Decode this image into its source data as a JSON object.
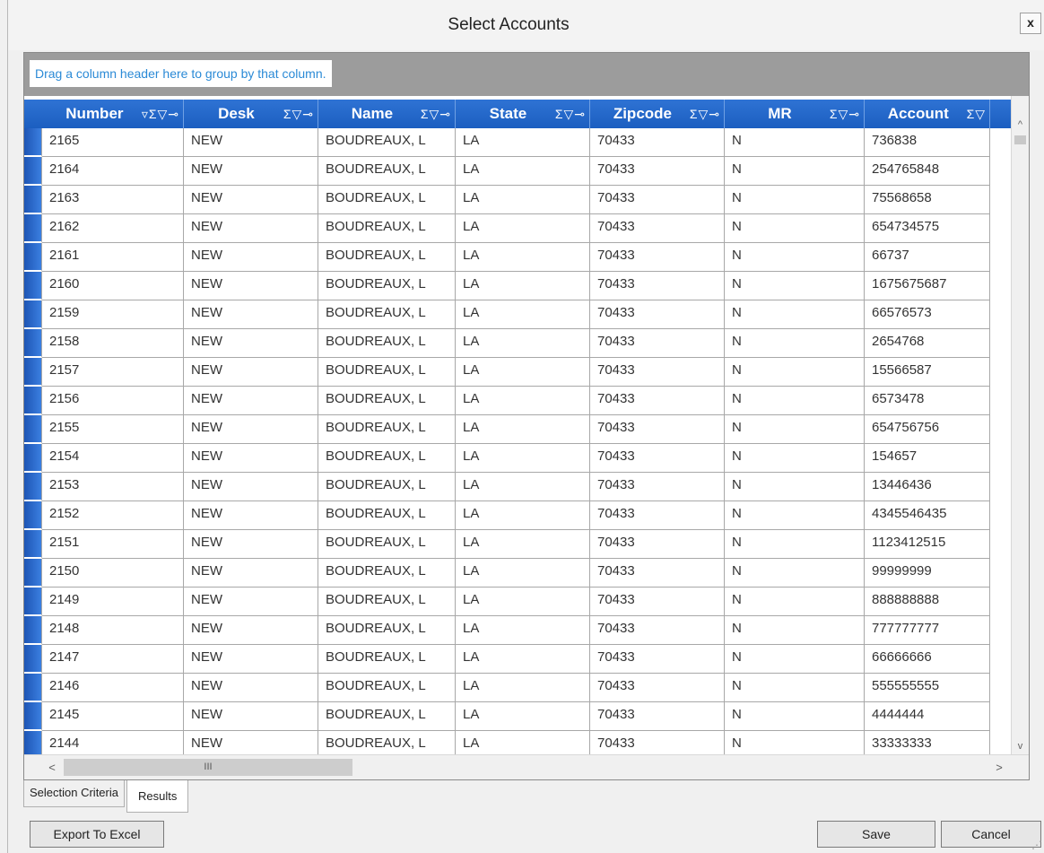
{
  "window": {
    "title": "Select Accounts",
    "close_label": "x"
  },
  "group_hint": "Drag a column header here to group by that column.",
  "columns": [
    {
      "label": "Number",
      "icons": "▿Σ▽⊸"
    },
    {
      "label": "Desk",
      "icons": "Σ▽⊸"
    },
    {
      "label": "Name",
      "icons": "Σ▽⊸"
    },
    {
      "label": "State",
      "icons": "Σ▽⊸"
    },
    {
      "label": "Zipcode",
      "icons": "Σ▽⊸"
    },
    {
      "label": "MR",
      "icons": "Σ▽⊸"
    },
    {
      "label": "Account",
      "icons": "Σ▽"
    }
  ],
  "rows": [
    [
      "2165",
      "NEW",
      "BOUDREAUX, L",
      "LA",
      "70433",
      "N",
      "736838"
    ],
    [
      "2164",
      "NEW",
      "BOUDREAUX, L",
      "LA",
      "70433",
      "N",
      "254765848"
    ],
    [
      "2163",
      "NEW",
      "BOUDREAUX, L",
      "LA",
      "70433",
      "N",
      "75568658"
    ],
    [
      "2162",
      "NEW",
      "BOUDREAUX, L",
      "LA",
      "70433",
      "N",
      "654734575"
    ],
    [
      "2161",
      "NEW",
      "BOUDREAUX, L",
      "LA",
      "70433",
      "N",
      "66737"
    ],
    [
      "2160",
      "NEW",
      "BOUDREAUX, L",
      "LA",
      "70433",
      "N",
      "1675675687"
    ],
    [
      "2159",
      "NEW",
      "BOUDREAUX, L",
      "LA",
      "70433",
      "N",
      "66576573"
    ],
    [
      "2158",
      "NEW",
      "BOUDREAUX, L",
      "LA",
      "70433",
      "N",
      "2654768"
    ],
    [
      "2157",
      "NEW",
      "BOUDREAUX, L",
      "LA",
      "70433",
      "N",
      "15566587"
    ],
    [
      "2156",
      "NEW",
      "BOUDREAUX, L",
      "LA",
      "70433",
      "N",
      "6573478"
    ],
    [
      "2155",
      "NEW",
      "BOUDREAUX, L",
      "LA",
      "70433",
      "N",
      "654756756"
    ],
    [
      "2154",
      "NEW",
      "BOUDREAUX, L",
      "LA",
      "70433",
      "N",
      "154657"
    ],
    [
      "2153",
      "NEW",
      "BOUDREAUX, L",
      "LA",
      "70433",
      "N",
      "13446436"
    ],
    [
      "2152",
      "NEW",
      "BOUDREAUX, L",
      "LA",
      "70433",
      "N",
      "4345546435"
    ],
    [
      "2151",
      "NEW",
      "BOUDREAUX, L",
      "LA",
      "70433",
      "N",
      "1123412515"
    ],
    [
      "2150",
      "NEW",
      "BOUDREAUX, L",
      "LA",
      "70433",
      "N",
      "99999999"
    ],
    [
      "2149",
      "NEW",
      "BOUDREAUX, L",
      "LA",
      "70433",
      "N",
      "888888888"
    ],
    [
      "2148",
      "NEW",
      "BOUDREAUX, L",
      "LA",
      "70433",
      "N",
      "777777777"
    ],
    [
      "2147",
      "NEW",
      "BOUDREAUX, L",
      "LA",
      "70433",
      "N",
      "66666666"
    ],
    [
      "2146",
      "NEW",
      "BOUDREAUX, L",
      "LA",
      "70433",
      "N",
      "555555555"
    ],
    [
      "2145",
      "NEW",
      "BOUDREAUX, L",
      "LA",
      "70433",
      "N",
      "4444444"
    ],
    [
      "2144",
      "NEW",
      "BOUDREAUX, L",
      "LA",
      "70433",
      "N",
      "33333333"
    ]
  ],
  "scroll": {
    "left": "<",
    "right": ">",
    "up": "^",
    "down": "v",
    "thumb_grip": "III"
  },
  "tabs": [
    {
      "label": "Selection Criteria"
    },
    {
      "label": "Results"
    }
  ],
  "buttons": {
    "export": "Export To Excel",
    "save": "Save",
    "cancel": "Cancel"
  },
  "colors": {
    "header": "#1f63c6",
    "selector": "#1d55b5",
    "link": "#2b8ad6"
  }
}
